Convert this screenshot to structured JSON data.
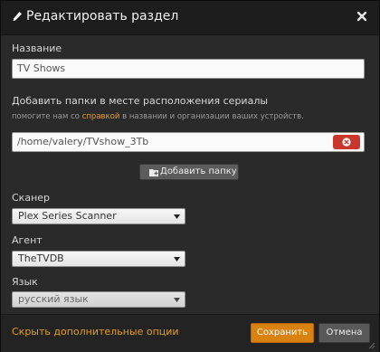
{
  "dialog": {
    "title": "Редактировать раздел",
    "icons": {
      "title": "pencil-icon",
      "close": "close-icon"
    }
  },
  "name_field": {
    "label": "Название",
    "value": "TV Shows"
  },
  "folders": {
    "label": "Добавить папки в месте расположения сериалы",
    "hint_before": "помогите нам со ",
    "hint_link": "справкой",
    "hint_after": " в названии и организации ваших устройств.",
    "path_value": "/home/valery/TVshow_3Tb",
    "remove_icon": "remove-circle-icon",
    "add_button_label": "Добавить папку",
    "add_button_icon": "folder-plus-icon"
  },
  "scanner": {
    "label": "Сканер",
    "selected": "Plex Series Scanner"
  },
  "agent": {
    "label": "Агент",
    "selected": "TheTVDB"
  },
  "language": {
    "label": "Язык",
    "selected": "русский язык"
  },
  "footer": {
    "more_options": "Скрыть дополнительные опции",
    "save_label": "Сохранить",
    "cancel_label": "Отмена"
  },
  "colors": {
    "accent": "#e59f1f",
    "save": "#d9820f",
    "remove": "#c9372c",
    "background": "#2a2a2a"
  }
}
